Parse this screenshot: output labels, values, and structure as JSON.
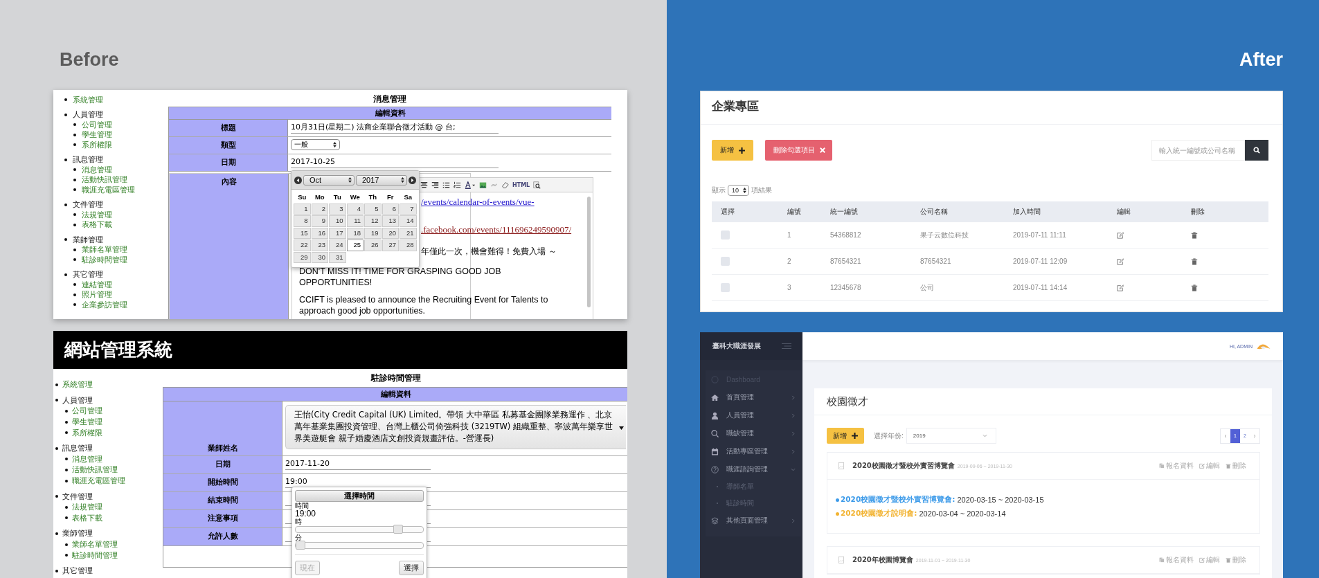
{
  "before": {
    "heading": "Before",
    "news_screen": {
      "sidebar": [
        {
          "kind": "link",
          "label": "系統管理"
        },
        {
          "kind": "group",
          "label": "人員管理",
          "children": [
            {
              "label": "公司管理"
            },
            {
              "label": "學生管理"
            },
            {
              "label": "系所權限"
            }
          ]
        },
        {
          "kind": "group",
          "label": "訊息管理",
          "children": [
            {
              "label": "消息管理"
            },
            {
              "label": "活動快訊管理"
            },
            {
              "label": "職涯充電區管理"
            }
          ]
        },
        {
          "kind": "group",
          "label": "文件管理",
          "children": [
            {
              "label": "法規管理"
            },
            {
              "label": "表格下載"
            }
          ]
        },
        {
          "kind": "group",
          "label": "業師管理",
          "children": [
            {
              "label": "業師名單管理"
            },
            {
              "label": "駐診時間管理"
            }
          ]
        },
        {
          "kind": "group",
          "label": "其它管理",
          "children": [
            {
              "label": "連結管理"
            },
            {
              "label": "照片管理"
            },
            {
              "label": "企業參訪管理"
            }
          ]
        }
      ],
      "title": "消息管理",
      "section": "編輯資料",
      "fields": [
        {
          "kind": "text",
          "label": "標題",
          "value": "10月31日(星期二) 法商企業聯合徵才活動 @ 台;"
        },
        {
          "kind": "select",
          "label": "類型",
          "value": "一般"
        },
        {
          "kind": "text",
          "label": "日期",
          "value": "2017-10-25"
        },
        {
          "kind": "editor",
          "label": "內容"
        }
      ],
      "editor": {
        "html_button": "HTML",
        "partial_lines": [
          {
            "kind": "link",
            "text": "/events/calendar-of-events/vue-"
          },
          {
            "kind": "visited_link",
            "text": ".facebook.com/events/111696249590907/"
          },
          {
            "kind": "text",
            "text": "年僅此一次，機會難得！免費入場 ～"
          }
        ],
        "paragraphs": [
          "DON'T MISS IT! TIME FOR GRASPING GOOD JOB OPPORTUNITIES!",
          "CCIFT is pleased to announce the Recruiting Event for Talents to approach good job opportunities."
        ]
      },
      "calendar": {
        "month": "Oct",
        "year": "2017",
        "weekdays": [
          "Su",
          "Mo",
          "Tu",
          "We",
          "Th",
          "Fr",
          "Sa"
        ],
        "days": [
          {
            "label": "1",
            "selected": false
          },
          {
            "label": "2",
            "selected": false
          },
          {
            "label": "3",
            "selected": false
          },
          {
            "label": "4",
            "selected": false
          },
          {
            "label": "5",
            "selected": false
          },
          {
            "label": "6",
            "selected": false
          },
          {
            "label": "7",
            "selected": false
          },
          {
            "label": "8",
            "selected": false
          },
          {
            "label": "9",
            "selected": false
          },
          {
            "label": "10",
            "selected": false
          },
          {
            "label": "11",
            "selected": false
          },
          {
            "label": "12",
            "selected": false
          },
          {
            "label": "13",
            "selected": false
          },
          {
            "label": "14",
            "selected": false
          },
          {
            "label": "15",
            "selected": false
          },
          {
            "label": "16",
            "selected": false
          },
          {
            "label": "17",
            "selected": false
          },
          {
            "label": "18",
            "selected": false
          },
          {
            "label": "19",
            "selected": false
          },
          {
            "label": "20",
            "selected": false
          },
          {
            "label": "21",
            "selected": false
          },
          {
            "label": "22",
            "selected": false
          },
          {
            "label": "23",
            "selected": false
          },
          {
            "label": "24",
            "selected": false
          },
          {
            "label": "25",
            "selected": true
          },
          {
            "label": "26",
            "selected": false
          },
          {
            "label": "27",
            "selected": false
          },
          {
            "label": "28",
            "selected": false
          },
          {
            "label": "29",
            "selected": false
          },
          {
            "label": "30",
            "selected": false
          },
          {
            "label": "31",
            "selected": false
          }
        ]
      }
    },
    "mentor_screen": {
      "banner": "網站管理系統",
      "sidebar": [
        {
          "kind": "link",
          "label": "系統管理"
        },
        {
          "kind": "group",
          "label": "人員管理",
          "children": [
            {
              "label": "公司管理"
            },
            {
              "label": "學生管理"
            },
            {
              "label": "系所權限"
            }
          ]
        },
        {
          "kind": "group",
          "label": "訊息管理",
          "children": [
            {
              "label": "消息管理"
            },
            {
              "label": "活動快訊管理"
            },
            {
              "label": "職涯充電區管理"
            }
          ]
        },
        {
          "kind": "group",
          "label": "文件管理",
          "children": [
            {
              "label": "法規管理"
            },
            {
              "label": "表格下載"
            }
          ]
        },
        {
          "kind": "group",
          "label": "業師管理",
          "children": [
            {
              "label": "業師名單管理"
            },
            {
              "label": "駐診時間管理"
            }
          ]
        },
        {
          "kind": "group",
          "label": "其它管理"
        }
      ],
      "title": "駐診時間管理",
      "section": "編輯資料",
      "fields": [
        {
          "kind": "select",
          "label": "業師姓名",
          "value": "王怡(City Credit Capital (UK) Limited。帶領 大中華區 私募基金團隊業務運作 、北京萬年基業集團投資管理、台灣上櫃公司倚強科技 (3219TW) 組織重整、寧波萬年樂享世界美遊艇會 親子婚慶酒店文創投資規畫評估。-營運長)"
        },
        {
          "kind": "text",
          "label": "日期",
          "value": "2017-11-20"
        },
        {
          "kind": "text",
          "label": "開始時間",
          "value": "19:00"
        },
        {
          "kind": "text",
          "label": "結束時間"
        },
        {
          "kind": "text",
          "label": "注意事項"
        },
        {
          "kind": "text",
          "label": "允許人數"
        }
      ],
      "time_picker": {
        "header": "選擇時間",
        "time_label": "時間",
        "time_value": "19:00",
        "sliders": [
          {
            "label": "時",
            "level": 0.83
          },
          {
            "label": "分",
            "level": 0
          }
        ],
        "buttons": [
          {
            "label": "現在",
            "disabled": true
          },
          {
            "label": "選擇",
            "disabled": false
          }
        ]
      }
    }
  },
  "after": {
    "heading": "After",
    "company_screen": {
      "title": "企業專區",
      "add_button": "新增",
      "delete_button": "刪除勾選項目",
      "search_placeholder": "輸入統一編號或公司名稱",
      "page_size": {
        "prefix": "顯示",
        "value": "10",
        "suffix": "項結果"
      },
      "columns": [
        "選擇",
        "編號",
        "統一編號",
        "公司名稱",
        "加入時間",
        "編輯",
        "刪除"
      ],
      "rows": [
        {
          "selected": false,
          "number": "1",
          "tax_id": "54368812",
          "name": "果子云數位科技",
          "joined": "2019-07-11 11:11"
        },
        {
          "selected": false,
          "number": "2",
          "tax_id": "87654321",
          "name": "87654321",
          "joined": "2019-07-11 12:09"
        },
        {
          "selected": false,
          "number": "3",
          "tax_id": "12345678",
          "name": "公司",
          "joined": "2019-07-11 14:14"
        }
      ]
    },
    "campus_screen": {
      "brand": "臺科大職涯發展",
      "greeting": "HI, ADMIN",
      "menu": [
        {
          "kind": "dashboard",
          "label": "Dashboard"
        },
        {
          "kind": "home",
          "label": "首頁管理",
          "expanded": false
        },
        {
          "kind": "user",
          "label": "人員管理",
          "expanded": false
        },
        {
          "kind": "search",
          "label": "職缺管理",
          "expanded": false
        },
        {
          "kind": "calendar",
          "label": "活動專區管理",
          "expanded": false
        },
        {
          "kind": "help",
          "label": "職涯諮詢管理",
          "expanded": true,
          "children": [
            {
              "label": "導師名單"
            },
            {
              "label": "駐診時間"
            }
          ]
        },
        {
          "kind": "layers",
          "label": "其他頁面管理",
          "expanded": false
        }
      ],
      "card_title": "校園徵才",
      "add_button": "新增",
      "year_label": "選擇年份:",
      "year_value": "2019",
      "pages": [
        {
          "label": "1",
          "selected": true
        },
        {
          "label": "2",
          "selected": false
        }
      ],
      "events": [
        {
          "title": "2020校園徵才暨校外實習博覽會",
          "dates": "2019-09-06 ~ 2019-11-30",
          "actions": [
            {
              "kind": "signup",
              "label": "報名資料"
            },
            {
              "kind": "edit",
              "label": "編輯"
            },
            {
              "kind": "delete",
              "label": "刪除"
            }
          ],
          "items": [
            {
              "name": "2020校園徵才暨校外實習博覽會:",
              "dates": "2020-03-15 ~ 2020-03-15",
              "color": "#3d9be9"
            },
            {
              "name": "2020校園徵才說明會:",
              "dates": "2020-03-04 ~ 2020-03-14",
              "color": "#f2b331"
            }
          ]
        },
        {
          "title": "2020年校園博覽會",
          "dates": "2019-11-01 ~ 2019-11-30",
          "actions": [
            {
              "kind": "signup",
              "label": "報名資料"
            },
            {
              "kind": "edit",
              "label": "編輯"
            },
            {
              "kind": "delete",
              "label": "刪除"
            }
          ]
        }
      ]
    }
  }
}
